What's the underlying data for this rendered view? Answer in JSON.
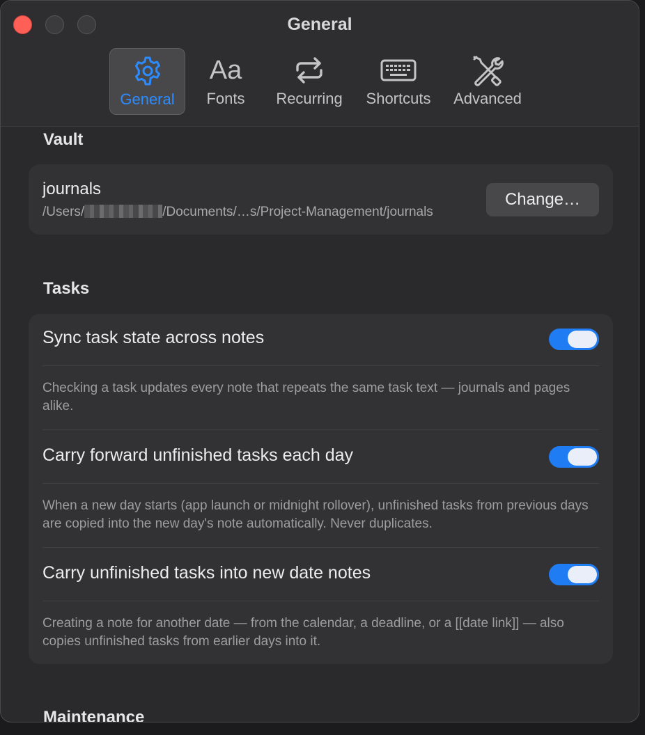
{
  "window": {
    "title": "General"
  },
  "tabs": [
    {
      "label": "General",
      "icon": "gear-icon",
      "active": true
    },
    {
      "label": "Fonts",
      "icon": "fonts-icon",
      "glyph": "Aa"
    },
    {
      "label": "Recurring",
      "icon": "repeat-icon"
    },
    {
      "label": "Shortcuts",
      "icon": "keyboard-icon"
    },
    {
      "label": "Advanced",
      "icon": "tools-icon"
    }
  ],
  "colors": {
    "accent": "#1f7cf2",
    "active_tab_text": "#2c8cff",
    "close_button": "#fe5f57"
  },
  "vault": {
    "heading": "Vault",
    "name": "journals",
    "path_prefix": "/Users/",
    "path_suffix": "/Documents/…s/Project-Management/journals",
    "change_label": "Change…"
  },
  "tasks": {
    "heading": "Tasks",
    "settings": [
      {
        "label": "Sync task state across notes",
        "enabled": true,
        "description": "Checking a task updates every note that repeats the same task text — journals and pages alike."
      },
      {
        "label": "Carry forward unfinished tasks each day",
        "enabled": true,
        "description": "When a new day starts (app launch or midnight rollover), unfinished tasks from previous days are copied into the new day's note automatically. Never duplicates."
      },
      {
        "label": "Carry unfinished tasks into new date notes",
        "enabled": true,
        "description": "Creating a note for another date — from the calendar, a deadline, or a [[date link]] — also copies unfinished tasks from earlier days into it."
      }
    ]
  },
  "maintenance": {
    "heading": "Maintenance"
  }
}
